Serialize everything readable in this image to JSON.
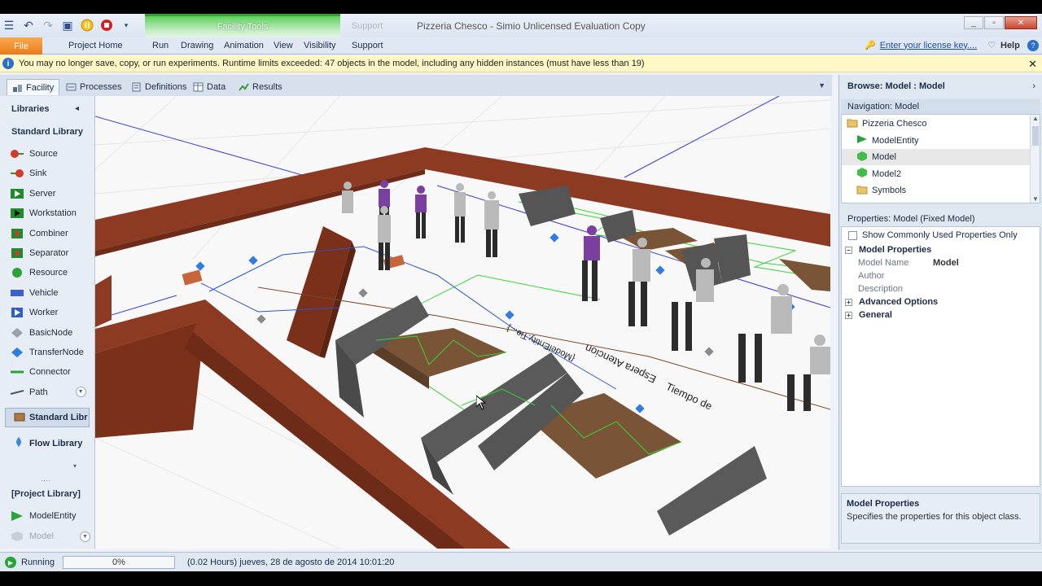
{
  "window": {
    "title": "Pizzeria Chesco - Simio Unlicensed Evaluation Copy",
    "context_tab_facility": "Facility Tools",
    "context_tab_support": "Support"
  },
  "ribbon": {
    "file": "File",
    "tabs": [
      "Project Home",
      "Run",
      "Drawing",
      "Animation",
      "View",
      "Visibility",
      "Support"
    ],
    "license_link": "Enter your license key....",
    "help": "Help"
  },
  "infobar": {
    "message": "You may no longer save, copy, or run experiments. Runtime limits exceeded: 47 objects in the model, including any hidden instances (must have less than 19)"
  },
  "window_tabs": [
    "Facility",
    "Processes",
    "Definitions",
    "Data",
    "Results"
  ],
  "libraries": {
    "header": "Libraries",
    "standard_header": "Standard Library",
    "items": [
      {
        "label": "Source",
        "icon": "source-icon"
      },
      {
        "label": "Sink",
        "icon": "sink-icon"
      },
      {
        "label": "Server",
        "icon": "server-icon"
      },
      {
        "label": "Workstation",
        "icon": "workstation-icon"
      },
      {
        "label": "Combiner",
        "icon": "combiner-icon"
      },
      {
        "label": "Separator",
        "icon": "separator-icon"
      },
      {
        "label": "Resource",
        "icon": "resource-icon"
      },
      {
        "label": "Vehicle",
        "icon": "vehicle-icon"
      },
      {
        "label": "Worker",
        "icon": "worker-icon"
      },
      {
        "label": "BasicNode",
        "icon": "basicnode-icon"
      },
      {
        "label": "TransferNode",
        "icon": "transfernode-icon"
      },
      {
        "label": "Connector",
        "icon": "connector-icon"
      },
      {
        "label": "Path",
        "icon": "path-icon"
      }
    ],
    "selected_library": "Standard Libr",
    "flow_library": "Flow Library",
    "project_header": "[Project Library]",
    "project_items": [
      "ModelEntity",
      "Model"
    ]
  },
  "browse": {
    "header": "Browse: Model : Model",
    "navigation_header": "Navigation: Model",
    "nav_items": [
      {
        "label": "Pizzeria Chesco",
        "icon": "folder-icon"
      },
      {
        "label": "ModelEntity",
        "icon": "entity-icon"
      },
      {
        "label": "Model",
        "icon": "model-icon",
        "selected": true
      },
      {
        "label": "Model2",
        "icon": "model-icon"
      },
      {
        "label": "Symbols",
        "icon": "folder-icon"
      }
    ],
    "properties_header": "Properties: Model (Fixed Model)",
    "show_common_label": "Show Commonly Used Properties Only",
    "model_properties_cat": "Model Properties",
    "props": [
      {
        "key": "Model Name",
        "value": "Model"
      },
      {
        "key": "Author",
        "value": ""
      },
      {
        "key": "Description",
        "value": ""
      }
    ],
    "advanced_cat": "Advanced Options",
    "general_cat": "General",
    "desc_title": "Model Properties",
    "desc_text": "Specifies the properties for this object class."
  },
  "viewport": {
    "labels": [
      "Tiempo de Espera Atencion: {ModelEntity.Tie...}",
      "Tiempo de",
      "Espera Atencion"
    ]
  },
  "status": {
    "state": "Running",
    "progress_text": "0%",
    "progress_fraction": 0.0,
    "sim_time": "(0.02 Hours) jueves, 28 de agosto de 2014 10:01:20"
  },
  "colors": {
    "accent": "#2b6fc4",
    "file_tab": "#e97b17",
    "context_green": "#29a829",
    "wall": "#8c3a22",
    "floor": "#f7f7f7"
  }
}
